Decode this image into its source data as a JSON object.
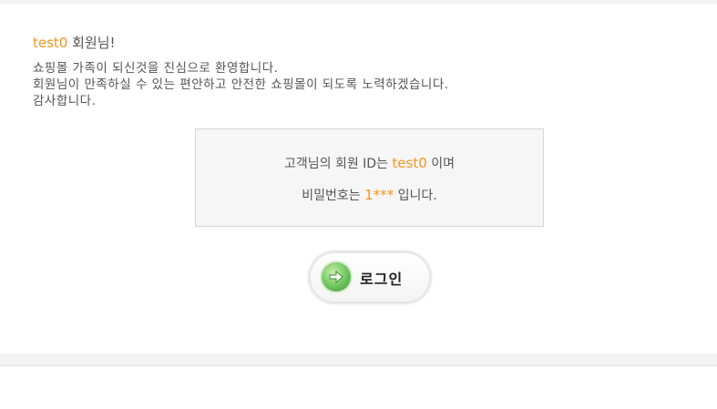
{
  "greeting": {
    "username": "test0",
    "suffix": " 회원님!"
  },
  "message": {
    "line1": "쇼핑몰 가족이 되신것을 진심으로 환영합니다.",
    "line2": "회원님이 만족하실 수 있는 편안하고 안전한 쇼핑몰이 되도록 노력하겠습니다.",
    "line3": "감사합니다."
  },
  "account_info": {
    "id_prefix": "고객님의 회원 ID는 ",
    "id_value": "test0",
    "id_suffix": " 이며",
    "pw_prefix": "비밀번호는 ",
    "pw_value": "1***",
    "pw_suffix": " 입니다."
  },
  "login_button": {
    "label": "로그인",
    "icon": "arrow-right-circle-icon"
  },
  "colors": {
    "accent": "#f7941d",
    "text": "#555555",
    "box_bg": "#f6f6f6",
    "box_border": "#d6d6d6",
    "icon_green": "#6cc45a"
  }
}
